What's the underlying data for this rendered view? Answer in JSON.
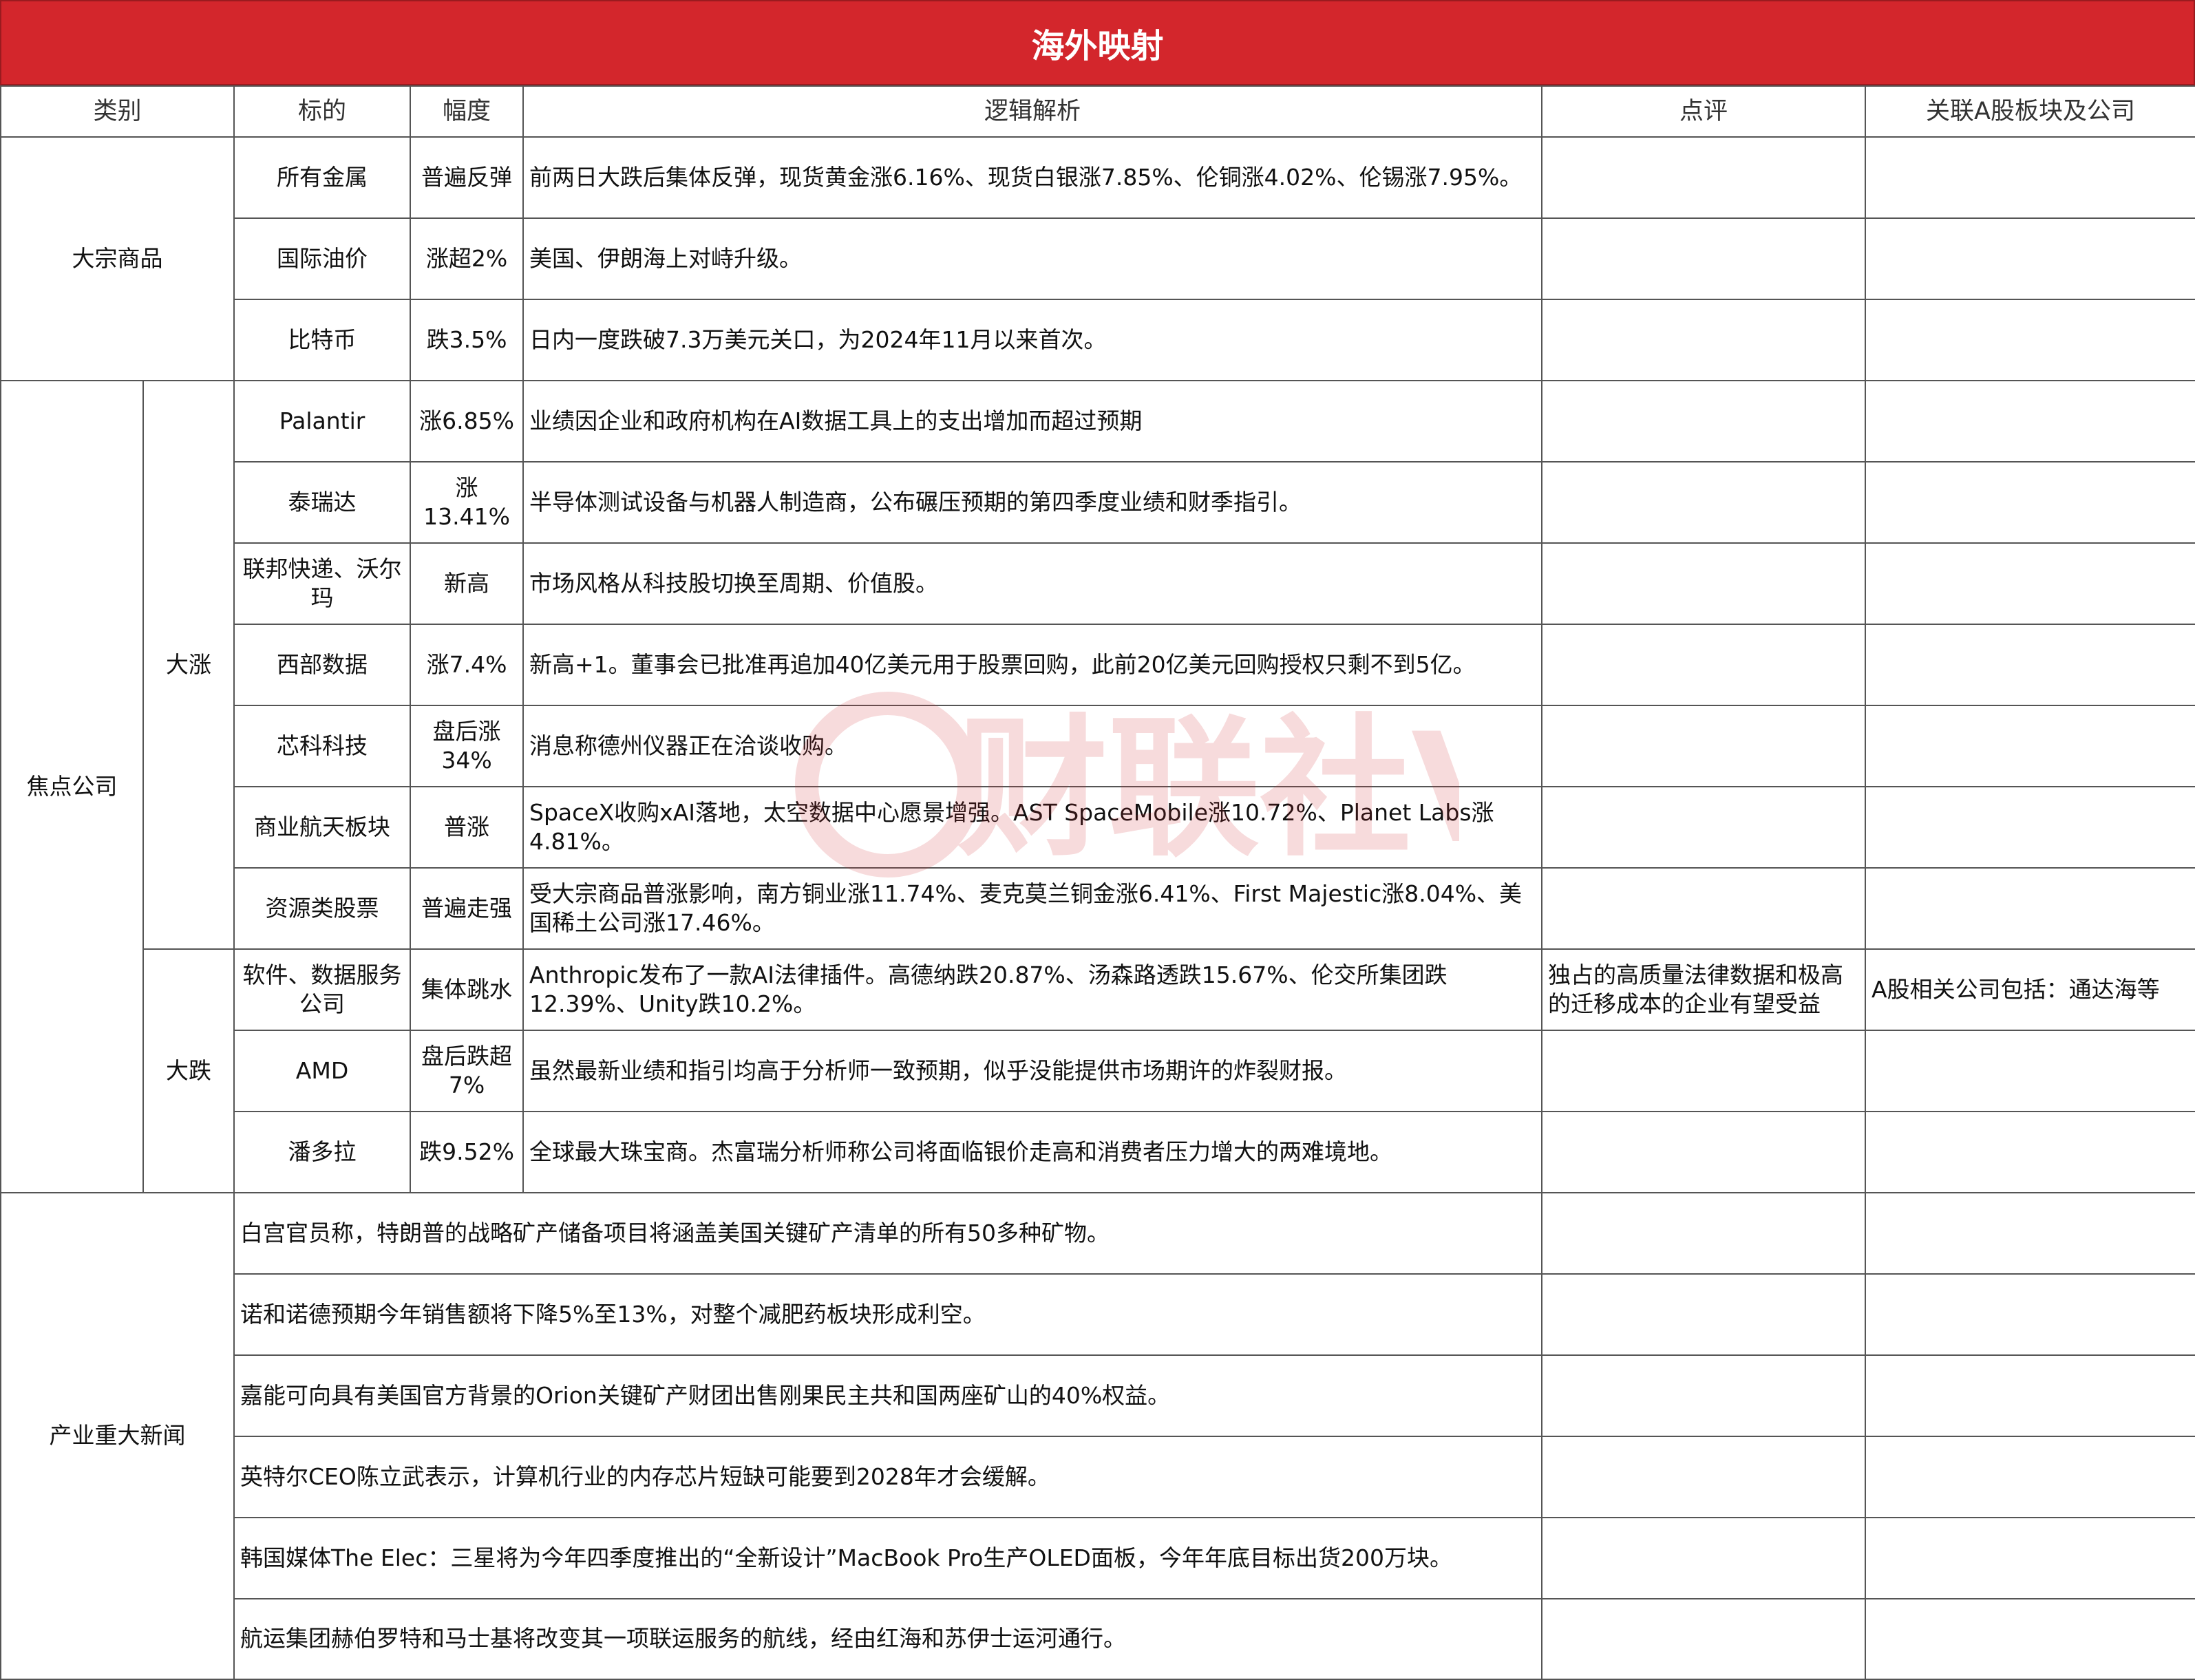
{
  "header": {
    "title": "海外映射"
  },
  "columns": [
    "类别",
    "标的",
    "幅度",
    "逻辑解析",
    "点评",
    "关联A股板块及公司"
  ],
  "commodities": {
    "category": "大宗商品",
    "rows": [
      {
        "target": "所有金属",
        "range": "普遍反弹",
        "logic": "前两日大跌后集体反弹，现货黄金涨6.16%、现货白银涨7.85%、伦铜涨4.02%、伦锡涨7.95%。",
        "comment": "",
        "related": ""
      },
      {
        "target": "国际油价",
        "range": "涨超2%",
        "logic": "美国、伊朗海上对峙升级。",
        "comment": "",
        "related": ""
      },
      {
        "target": "比特币",
        "range": "跌3.5%",
        "logic": "日内一度跌破7.3万美元关口，为2024年11月以来首次。",
        "comment": "",
        "related": ""
      }
    ]
  },
  "focus": {
    "category": "焦点公司",
    "up_label": "大涨",
    "down_label": "大跌",
    "up_rows": [
      {
        "target": "Palantir",
        "range": "涨6.85%",
        "logic": "业绩因企业和政府机构在AI数据工具上的支出增加而超过预期",
        "comment": "",
        "related": ""
      },
      {
        "target": "泰瑞达",
        "range": "涨13.41%",
        "logic": "半导体测试设备与机器人制造商，公布碾压预期的第四季度业绩和财季指引。",
        "comment": "",
        "related": ""
      },
      {
        "target": "联邦快递、沃尔玛",
        "range": "新高",
        "logic": "市场风格从科技股切换至周期、价值股。",
        "comment": "",
        "related": ""
      },
      {
        "target": "西部数据",
        "range": "涨7.4%",
        "logic": "新高+1。董事会已批准再追加40亿美元用于股票回购，此前20亿美元回购授权只剩不到5亿。",
        "comment": "",
        "related": ""
      },
      {
        "target": "芯科科技",
        "range": "盘后涨34%",
        "logic": "消息称德州仪器正在洽谈收购。",
        "comment": "",
        "related": ""
      },
      {
        "target": "商业航天板块",
        "range": "普涨",
        "logic": "SpaceX收购xAI落地，太空数据中心愿景增强。AST SpaceMobile涨10.72%、Planet Labs涨4.81%。",
        "comment": "",
        "related": ""
      },
      {
        "target": "资源类股票",
        "range": "普遍走强",
        "logic": "受大宗商品普涨影响，南方铜业涨11.74%、麦克莫兰铜金涨6.41%、First Majestic涨8.04%、美国稀土公司涨17.46%。",
        "comment": "",
        "related": ""
      }
    ],
    "down_rows": [
      {
        "target": "软件、数据服务公司",
        "range": "集体跳水",
        "logic": "Anthropic发布了一款AI法律插件。高德纳跌20.87%、汤森路透跌15.67%、伦交所集团跌12.39%、Unity跌10.2%。",
        "comment": "独占的高质量法律数据和极高的迁移成本的企业有望受益",
        "related": "A股相关公司包括：通达海等"
      },
      {
        "target": "AMD",
        "range": "盘后跌超7%",
        "logic": "虽然最新业绩和指引均高于分析师一致预期，似乎没能提供市场期许的炸裂财报。",
        "comment": "",
        "related": ""
      },
      {
        "target": "潘多拉",
        "range": "跌9.52%",
        "logic": "全球最大珠宝商。杰富瑞分析师称公司将面临银价走高和消费者压力增大的两难境地。",
        "comment": "",
        "related": ""
      }
    ]
  },
  "industry": {
    "category": "产业重大新闻",
    "rows": [
      {
        "news": "白宫官员称，特朗普的战略矿产储备项目将涵盖美国关键矿产清单的所有50多种矿物。",
        "comment": "",
        "related": ""
      },
      {
        "news": "诺和诺德预期今年销售额将下降5%至13%，对整个减肥药板块形成利空。",
        "comment": "",
        "related": ""
      },
      {
        "news": "嘉能可向具有美国官方背景的Orion关键矿产财团出售刚果民主共和国两座矿山的40%权益。",
        "comment": "",
        "related": ""
      },
      {
        "news": "英特尔CEO陈立武表示，计算机行业的内存芯片短缺可能要到2028年才会缓解。",
        "comment": "",
        "related": ""
      },
      {
        "news": "韩国媒体The Elec：三星将为今年四季度推出的“全新设计”MacBook Pro生产OLED面板，今年年底目标出货200万块。",
        "comment": "",
        "related": ""
      },
      {
        "news": "航运集团赫伯罗特和马士基将改变其一项联运服务的航线，经由红海和苏伊士运河通行。",
        "comment": "",
        "related": ""
      }
    ]
  },
  "watermark": {
    "text": "财联社VIP",
    "color": "#d3262c"
  }
}
